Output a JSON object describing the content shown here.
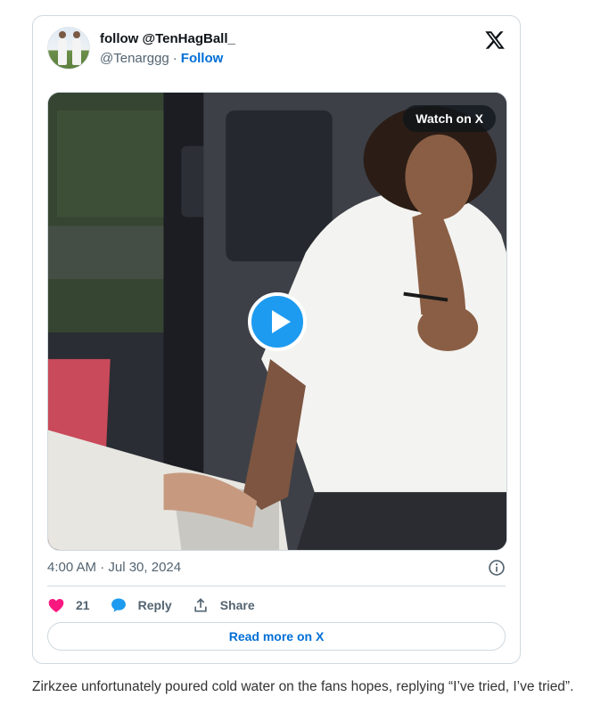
{
  "tweet": {
    "display_name": "follow @TenHagBall_",
    "handle": "@Tenarggg",
    "separator": "·",
    "follow_label": "Follow",
    "timestamp": "4:00 AM · Jul 30, 2024",
    "icons": {
      "logo": "x-logo-icon",
      "info": "info-icon",
      "like": "heart-icon",
      "reply": "speech-bubble-icon",
      "share": "share-upload-icon",
      "play": "play-icon"
    },
    "media": {
      "watch_label": "Watch on X"
    },
    "actions": {
      "like_count": "21",
      "reply_label": "Reply",
      "share_label": "Share"
    },
    "read_more_label": "Read more on X"
  },
  "article": {
    "paragraph": "Zirkzee unfortunately poured cold water on the fans hopes, replying “I’ve tried, I’ve tried”."
  },
  "colors": {
    "accent_blue": "#1d9bf0",
    "link_blue": "#006fd6",
    "like_pink": "#f91880",
    "muted_text": "#536471",
    "border": "#cfd9de"
  }
}
